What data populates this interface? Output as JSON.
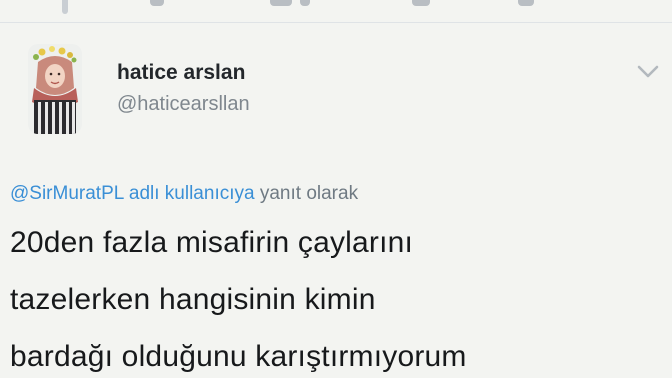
{
  "tweet": {
    "author_name": "hatice arslan",
    "author_handle": "@haticearsllan",
    "reply_context": {
      "mention": "@SirMuratPL adlı kullanıcıya",
      "suffix": "yanıt olarak"
    },
    "text_lines": [
      "20den fazla misafirin çaylarını",
      "tazelerken hangisinin kimin",
      "bardağı olduğunu karıştırmıyorum"
    ]
  },
  "icons": {
    "menu": "chevron-down-icon"
  },
  "colors": {
    "background": "#f3f4f1",
    "link": "#3a8fd6",
    "muted": "#7f878e",
    "text": "#17191b"
  }
}
